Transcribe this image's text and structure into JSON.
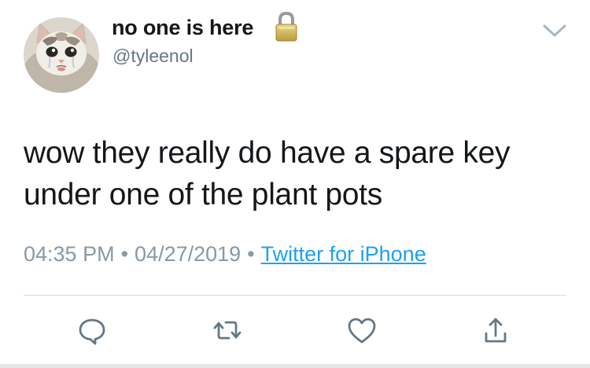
{
  "user": {
    "display_name": "no one is here",
    "handle": "@tyleenol",
    "protected_icon": "lock-icon",
    "avatar": "crying-cat-avatar"
  },
  "tweet": {
    "text": "wow they really do have a spare key under one of the plant pots"
  },
  "meta": {
    "time": "04:35 PM",
    "separator_1": "•",
    "date": "04/27/2019",
    "separator_2": "•",
    "source": "Twitter for iPhone"
  },
  "actions": [
    {
      "icon": "reply-icon"
    },
    {
      "icon": "retweet-icon"
    },
    {
      "icon": "like-heart-icon"
    },
    {
      "icon": "share-icon"
    }
  ],
  "menu_icon": "chevron-down-icon",
  "colors": {
    "text": "#14171a",
    "secondary": "#657786",
    "meta": "#8899a6",
    "link": "#1da1f2",
    "icon": "#657786",
    "divider": "#d6dbe0"
  }
}
